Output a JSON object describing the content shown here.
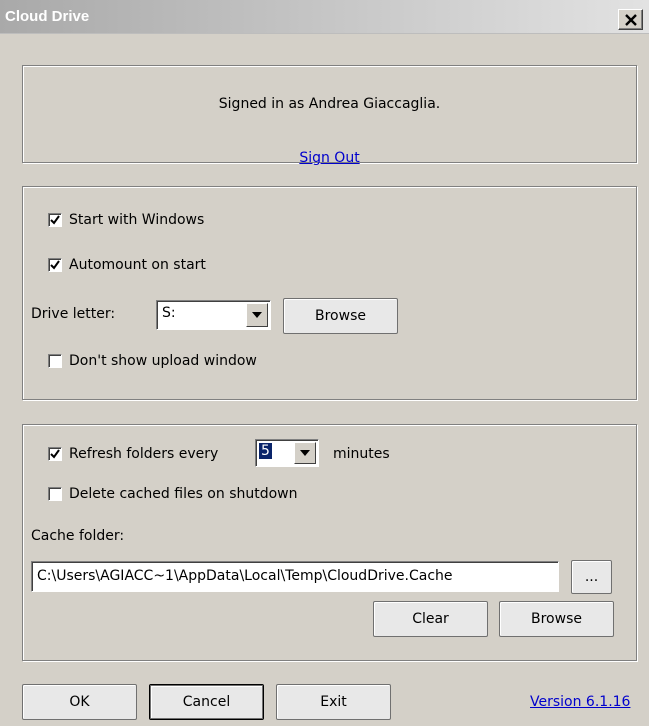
{
  "window": {
    "title": "Cloud Drive",
    "close_icon": "close-icon"
  },
  "account": {
    "signed_in_text": "Signed in as Andrea Giaccaglia.",
    "sign_out_label": "Sign Out"
  },
  "startup": {
    "start_with_windows": {
      "label": "Start with Windows",
      "checked": true
    },
    "automount": {
      "label": "Automount on start",
      "checked": true
    },
    "drive_letter_label": "Drive letter:",
    "drive_letter_value": "S:",
    "browse_label": "Browse",
    "hide_upload_window": {
      "label": "Don't show upload window",
      "checked": false
    }
  },
  "cache": {
    "refresh": {
      "label": "Refresh folders every",
      "checked": true,
      "value": "5",
      "unit": "minutes"
    },
    "delete_cached": {
      "label": "Delete cached files on shutdown",
      "checked": false
    },
    "cache_folder_label": "Cache folder:",
    "cache_folder_path": "C:\\Users\\AGIACC~1\\AppData\\Local\\Temp\\CloudDrive.Cache",
    "ellipsis_label": "...",
    "clear_label": "Clear",
    "browse_label": "Browse"
  },
  "footer": {
    "ok_label": "OK",
    "cancel_label": "Cancel",
    "exit_label": "Exit",
    "version_label": "Version 6.1.16"
  },
  "colors": {
    "face": "#d4d0c8",
    "link": "#0000cc",
    "selection": "#0a246a"
  }
}
